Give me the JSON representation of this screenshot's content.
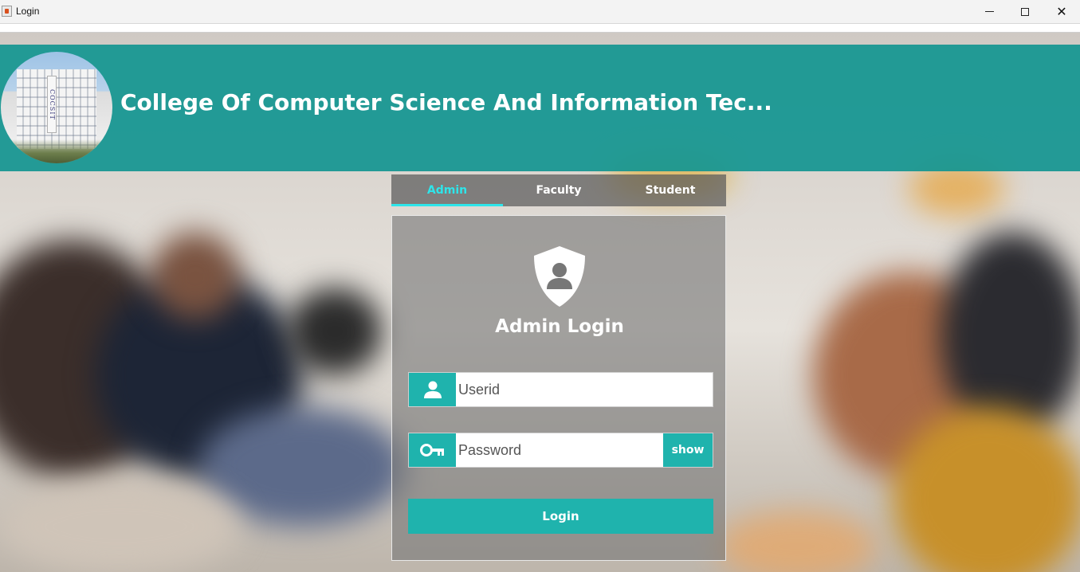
{
  "window": {
    "title": "Login"
  },
  "header": {
    "title": "College Of Computer Science And Information Tec...",
    "logo_sign_text": "COCSIT"
  },
  "tabs": [
    {
      "label": "Admin",
      "active": true
    },
    {
      "label": "Faculty",
      "active": false
    },
    {
      "label": "Student",
      "active": false
    }
  ],
  "login": {
    "title": "Admin Login",
    "userid_placeholder": "Userid",
    "password_placeholder": "Password",
    "show_label": "show",
    "login_label": "Login"
  },
  "colors": {
    "accent": "#1fb3ad",
    "header_band": "#149691",
    "active_tab": "#2ee5ea"
  }
}
